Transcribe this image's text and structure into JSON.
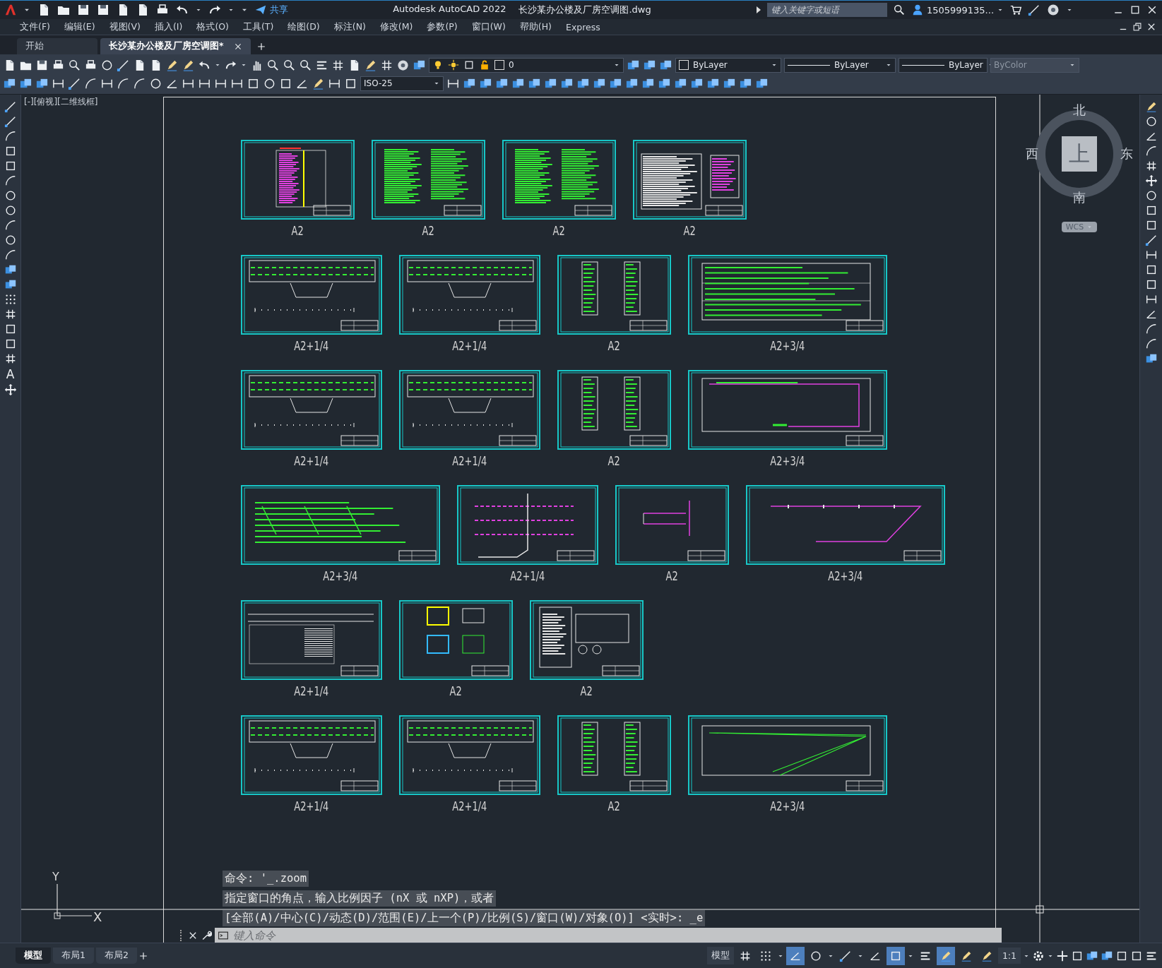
{
  "title_bar": {
    "app_title": "Autodesk AutoCAD 2022",
    "file_name": "长沙某办公楼及厂房空调图.dwg",
    "share": "共享",
    "search": {
      "placeholder": "键入关键字或短语"
    },
    "user": "1505999135..."
  },
  "menu_bar": {
    "items": [
      "文件(F)",
      "编辑(E)",
      "视图(V)",
      "插入(I)",
      "格式(O)",
      "工具(T)",
      "绘图(D)",
      "标注(N)",
      "修改(M)",
      "参数(P)",
      "窗口(W)",
      "帮助(H)",
      "Express"
    ]
  },
  "document_tabs": [
    {
      "label": "开始",
      "selected": false
    },
    {
      "label": "长沙某办公楼及厂房空调图*",
      "selected": true
    }
  ],
  "toolbar": {
    "layer": "0",
    "color_setting": "ByLayer",
    "linetype": "ByLayer",
    "lineweight": "ByLayer",
    "plot_style": {
      "value": "ByColor",
      "disabled": true
    },
    "dim_style": "ISO-25"
  },
  "draw_toolbar": {
    "text_tool": "A"
  },
  "viewport": {
    "label": "[-][俯视][二维线框]",
    "sheets": [
      [
        {
          "kind": "chart-table",
          "label": "A2"
        },
        {
          "kind": "notes",
          "label": "A2"
        },
        {
          "kind": "notes",
          "label": "A2"
        },
        {
          "kind": "schedule",
          "label": "A2"
        }
      ],
      [
        {
          "kind": "floor-plan",
          "label": "A2+1/4"
        },
        {
          "kind": "floor-plan",
          "label": "A2+1/4"
        },
        {
          "kind": "riser-plan",
          "label": "A2"
        },
        {
          "kind": "long-plan",
          "label": "A2+3/4"
        }
      ],
      [
        {
          "kind": "floor-plan",
          "label": "A2+1/4"
        },
        {
          "kind": "floor-plan",
          "label": "A2+1/4"
        },
        {
          "kind": "riser-plan",
          "label": "A2"
        },
        {
          "kind": "pipe-plan",
          "label": "A2+3/4"
        }
      ],
      [
        {
          "kind": "isometric-wide",
          "label": "A2+3/4"
        },
        {
          "kind": "isometric",
          "label": "A2+1/4"
        },
        {
          "kind": "isometric-small",
          "label": "A2"
        },
        {
          "kind": "pipe-diagram",
          "label": "A2+3/4"
        }
      ],
      [
        {
          "kind": "section",
          "label": "A2+1/4"
        },
        {
          "kind": "equipment",
          "label": "A2"
        },
        {
          "kind": "details",
          "label": "A2"
        }
      ],
      [
        {
          "kind": "floor-plan",
          "label": "A2+1/4"
        },
        {
          "kind": "floor-plan",
          "label": "A2+1/4"
        },
        {
          "kind": "riser-plan",
          "label": "A2"
        },
        {
          "kind": "duct-diagram",
          "label": "A2+3/4"
        }
      ]
    ],
    "viewcube": {
      "north": "北",
      "south": "南",
      "east": "东",
      "west": "西",
      "face": "上",
      "coordinate_system": "WCS"
    },
    "ucs": {
      "x": "X",
      "y": "Y"
    }
  },
  "command_line": {
    "history": [
      "命令: '_.zoom",
      "指定窗口的角点，输入比例因子 (nX 或 nXP)，或者",
      "[全部(A)/中心(C)/动态(D)/范围(E)/上一个(P)/比例(S)/窗口(W)/对象(O)] <实时>: _e"
    ],
    "placeholder": "键入命令"
  },
  "status_bar": {
    "layout_tabs": [
      {
        "label": "模型",
        "selected": true
      },
      {
        "label": "布局1",
        "selected": false
      },
      {
        "label": "布局2",
        "selected": false
      }
    ],
    "space": "模型",
    "scale": "1:1",
    "toggles": [
      {
        "on": false
      },
      {
        "on": false
      },
      {
        "on": true
      },
      {
        "on": false
      },
      {
        "on": false
      },
      {
        "on": false
      },
      {
        "on": true
      },
      {
        "on": false
      },
      {
        "on": true
      },
      {
        "on": false
      },
      {
        "on": false
      }
    ]
  }
}
